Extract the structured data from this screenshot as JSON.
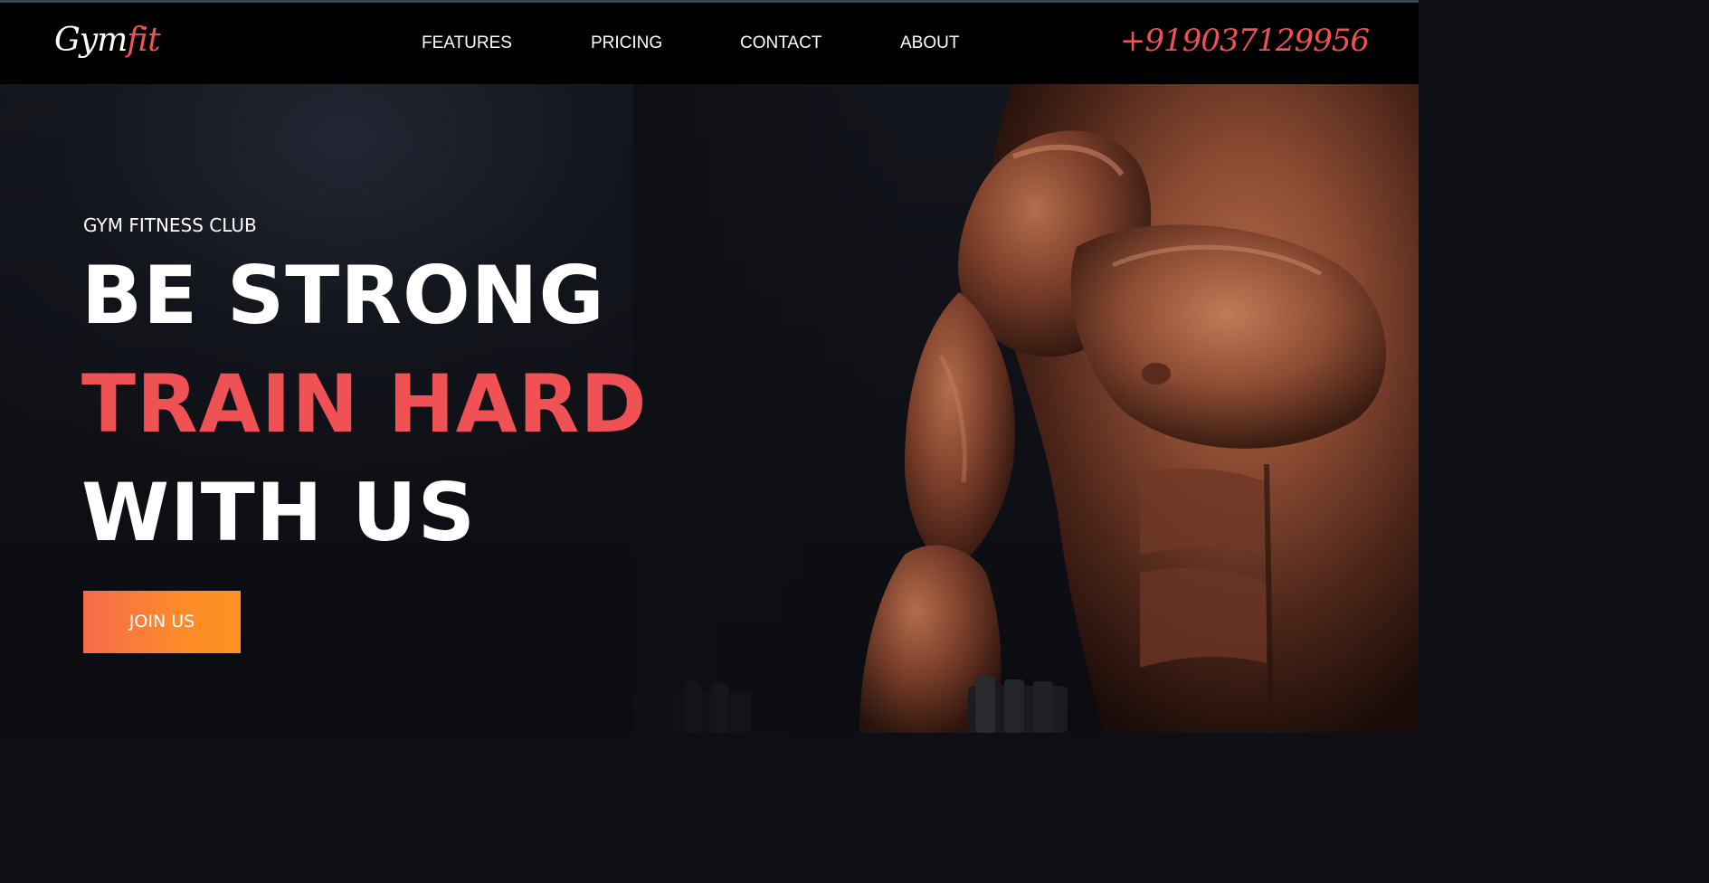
{
  "navbar": {
    "logo_main": "Gym",
    "logo_accent": "fit",
    "links": [
      {
        "label": "FEATURES"
      },
      {
        "label": "PRICING"
      },
      {
        "label": "CONTACT"
      },
      {
        "label": "ABOUT"
      }
    ],
    "phone": "+919037129956"
  },
  "hero": {
    "eyebrow": "GYM FITNESS CLUB",
    "headline_line1": "BE STRONG",
    "headline_line2": "TRAIN HARD",
    "headline_line3": "WITH US",
    "cta_label": "JOIN US"
  },
  "colors": {
    "accent": "#ef5154",
    "cta_gradient_start": "#f66a4c",
    "cta_gradient_end": "#ff9320",
    "navbar_bg": "#000000",
    "hero_bg": "#0e0f14"
  },
  "icons": {
    "hero_image": "muscular-man-with-dumbbells-image"
  }
}
